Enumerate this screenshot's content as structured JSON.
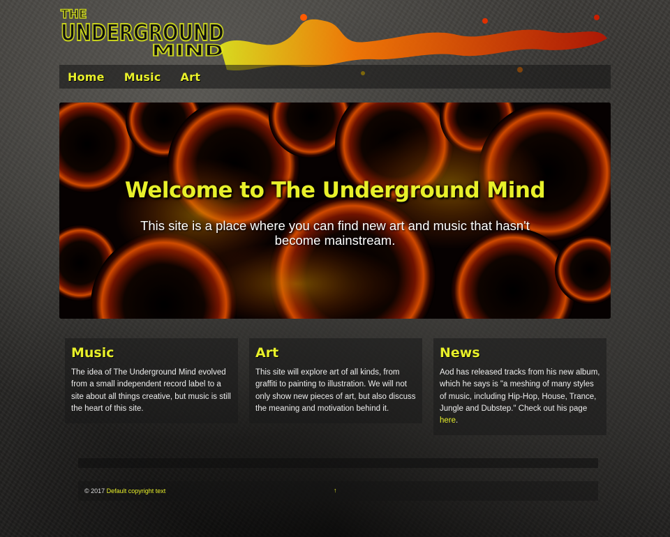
{
  "logo": {
    "line1": "THE",
    "line2": "UNDERGROUND",
    "line3": "MIND"
  },
  "nav": {
    "items": [
      {
        "label": "Home"
      },
      {
        "label": "Music"
      },
      {
        "label": "Art"
      }
    ]
  },
  "hero": {
    "title": "Welcome to The Underground Mind",
    "text": "This site is a place where you can find new art and music that hasn't become mainstream."
  },
  "columns": [
    {
      "title": "Music",
      "text": "The idea of The Underground Mind evolved from a small independent record label to a site about all things creative, but music is still the heart of this site."
    },
    {
      "title": "Art",
      "text": "This site will explore art of all kinds, from graffiti to painting to illustration. We will not only show new pieces of art, but also discuss the meaning and motivation behind it."
    },
    {
      "title": "News",
      "text": "Aod has released tracks from his new album, which he says is \"a meshing of many styles of music, including Hip-Hop, House, Trance, Jungle and Dubstep.\" Check out his page ",
      "link": "here",
      "after": "."
    }
  ],
  "footer": {
    "copyright": "© 2017",
    "link": "Default copyright text",
    "up": "↑"
  },
  "colors": {
    "accent": "#e8f02a",
    "hero_orange": "#ff5a00",
    "hero_red": "#c81e00"
  }
}
